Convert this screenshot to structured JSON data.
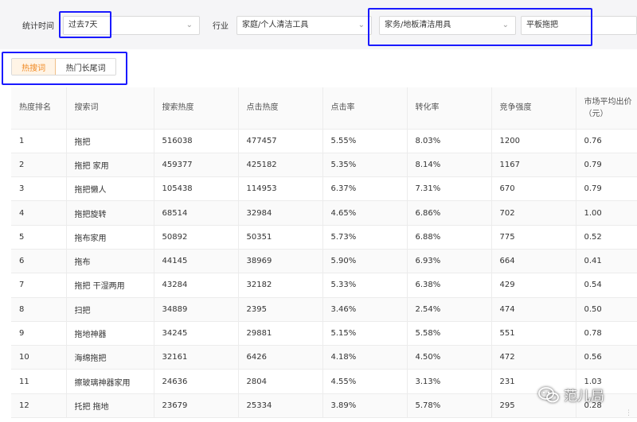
{
  "filters": {
    "time_label": "统计时间",
    "time_value": "过去7天",
    "industry_label": "行业",
    "industry_value": "家庭/个人清洁工具",
    "sub_category_value": "家务/地板清洁用具",
    "keyword_value": "平板拖把",
    "highlight_color": "#1a1aff"
  },
  "tabs": {
    "active": "热搜词",
    "inactive": "热门长尾词",
    "active_color": "#f08a24"
  },
  "table": {
    "headers": [
      "热度排名",
      "搜索词",
      "搜索热度",
      "点击热度",
      "点击率",
      "转化率",
      "竞争强度",
      "市场平均出价（元）"
    ],
    "rows": [
      [
        "1",
        "拖把",
        "516038",
        "477457",
        "5.55%",
        "8.03%",
        "1200",
        "0.76"
      ],
      [
        "2",
        "拖把 家用",
        "459377",
        "425182",
        "5.35%",
        "8.14%",
        "1167",
        "0.79"
      ],
      [
        "3",
        "拖把懒人",
        "105438",
        "114953",
        "6.37%",
        "7.31%",
        "670",
        "0.79"
      ],
      [
        "4",
        "拖把旋转",
        "68514",
        "32984",
        "4.65%",
        "6.86%",
        "702",
        "1.00"
      ],
      [
        "5",
        "拖布家用",
        "50892",
        "50351",
        "5.73%",
        "6.88%",
        "775",
        "0.52"
      ],
      [
        "6",
        "拖布",
        "44145",
        "38969",
        "5.90%",
        "6.93%",
        "664",
        "0.41"
      ],
      [
        "7",
        "拖把 干湿两用",
        "43284",
        "32182",
        "5.33%",
        "6.38%",
        "429",
        "0.54"
      ],
      [
        "8",
        "扫把",
        "34889",
        "2395",
        "3.46%",
        "2.54%",
        "474",
        "0.50"
      ],
      [
        "9",
        "拖地神器",
        "34245",
        "29881",
        "5.15%",
        "5.58%",
        "551",
        "0.78"
      ],
      [
        "10",
        "海绵拖把",
        "32161",
        "6426",
        "4.18%",
        "4.50%",
        "472",
        "0.56"
      ],
      [
        "11",
        "擦玻璃神器家用",
        "24636",
        "2804",
        "4.55%",
        "3.13%",
        "231",
        "1.03"
      ],
      [
        "12",
        "托把 拖地",
        "23679",
        "25334",
        "3.89%",
        "5.78%",
        "295",
        "0.28"
      ]
    ]
  },
  "watermark": {
    "text": "范儿局",
    "icon": "wechat-icon"
  }
}
